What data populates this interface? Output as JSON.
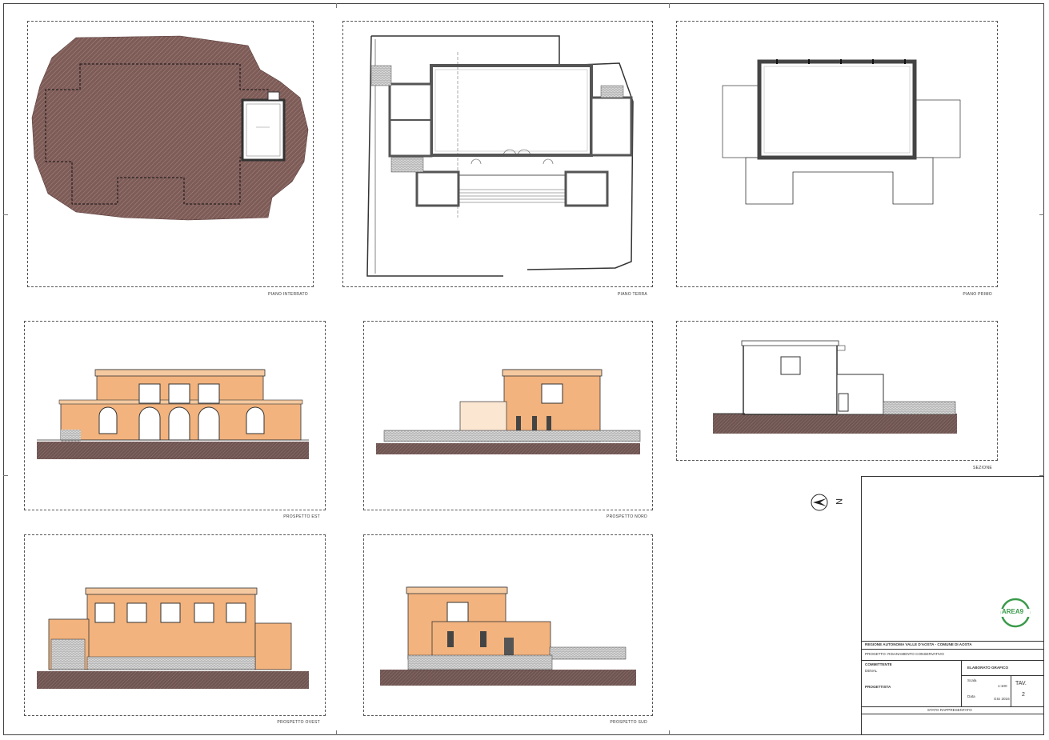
{
  "sheet": {
    "drawings": [
      {
        "id": "piano-interrato",
        "label": "PIANO INTERRATO"
      },
      {
        "id": "piano-terra",
        "label": "PIANO TERRA"
      },
      {
        "id": "piano-primo",
        "label": "PIANO PRIMO"
      },
      {
        "id": "prospetto-est",
        "label": "PROSPETTO EST"
      },
      {
        "id": "prospetto-nord",
        "label": "PROSPETTO NORD"
      },
      {
        "id": "sezione",
        "label": "SEZIONE"
      },
      {
        "id": "prospetto-ovest",
        "label": "PROSPETTO OVEST"
      },
      {
        "id": "prospetto-sud",
        "label": "PROSPETTO SUD"
      }
    ],
    "north_letter": "N"
  },
  "title_block": {
    "logo_text": "AREA9",
    "project_line": "REGIONE AUTONOMA VALLE D'AOSTA - COMUNE DI AOSTA",
    "progetto": "PROGETTO:  RISANAMENTO CONSERVATIVO",
    "committente": "COMMITTENTE",
    "committente_sub": "DENAL",
    "elaborato": "ELABORATO GRAFICO",
    "progettista": "PROGETTISTA",
    "scala_label": "Scala",
    "scala_value": "1:100",
    "data_label": "Data",
    "data_value": "GIU 2016",
    "tav_label": "TAV.",
    "tav_number": "2",
    "revisioni": "STATO RAPPRESENTATO",
    "colors": {
      "wall": "#f2b37e",
      "soil": "#7a5a55",
      "line": "#333333"
    }
  }
}
